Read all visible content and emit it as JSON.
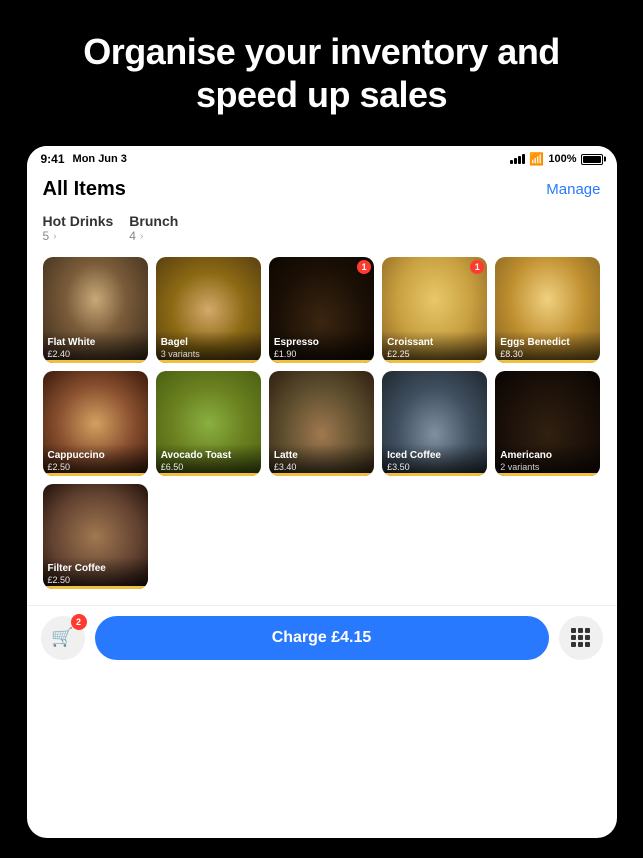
{
  "hero": {
    "title": "Organise your inventory and speed up sales"
  },
  "statusBar": {
    "time": "9:41",
    "date": "Mon Jun 3",
    "battery": "100%"
  },
  "header": {
    "title": "All Items",
    "manage_label": "Manage"
  },
  "categories": [
    {
      "name": "Hot Drinks",
      "count": "5"
    },
    {
      "name": "Brunch",
      "count": "4"
    }
  ],
  "items": [
    {
      "id": "flat-white",
      "name": "Flat White",
      "price": "£2.40",
      "variants": null,
      "badge": null,
      "img_class": "img-flat-white"
    },
    {
      "id": "bagel",
      "name": "Bagel",
      "price": null,
      "variants": "3 variants",
      "badge": null,
      "img_class": "img-bagel"
    },
    {
      "id": "espresso",
      "name": "Espresso",
      "price": "£1.90",
      "variants": null,
      "badge": "1",
      "img_class": "img-espresso"
    },
    {
      "id": "croissant",
      "name": "Croissant",
      "price": "£2.25",
      "variants": null,
      "badge": "1",
      "img_class": "img-croissant"
    },
    {
      "id": "eggs-benedict",
      "name": "Eggs Benedict",
      "price": "£8.30",
      "variants": null,
      "badge": null,
      "img_class": "img-eggs-benedict"
    },
    {
      "id": "cappuccino",
      "name": "Cappuccino",
      "price": "£2.50",
      "variants": null,
      "badge": null,
      "img_class": "img-cappuccino"
    },
    {
      "id": "avocado-toast",
      "name": "Avocado Toast",
      "price": "£6.50",
      "variants": null,
      "badge": null,
      "img_class": "img-avocado-toast"
    },
    {
      "id": "latte",
      "name": "Latte",
      "price": "£3.40",
      "variants": null,
      "badge": null,
      "img_class": "img-latte"
    },
    {
      "id": "iced-coffee",
      "name": "Iced Coffee",
      "price": "£3.50",
      "variants": null,
      "badge": null,
      "img_class": "img-iced-coffee"
    },
    {
      "id": "americano",
      "name": "Americano",
      "price": null,
      "variants": "2 variants",
      "badge": null,
      "img_class": "img-americano"
    },
    {
      "id": "filter-coffee",
      "name": "Filter Coffee",
      "price": "£2.50",
      "variants": null,
      "badge": null,
      "img_class": "img-filter-coffee"
    }
  ],
  "bottomBar": {
    "cart_badge": "2",
    "charge_label": "Charge £4.15"
  }
}
